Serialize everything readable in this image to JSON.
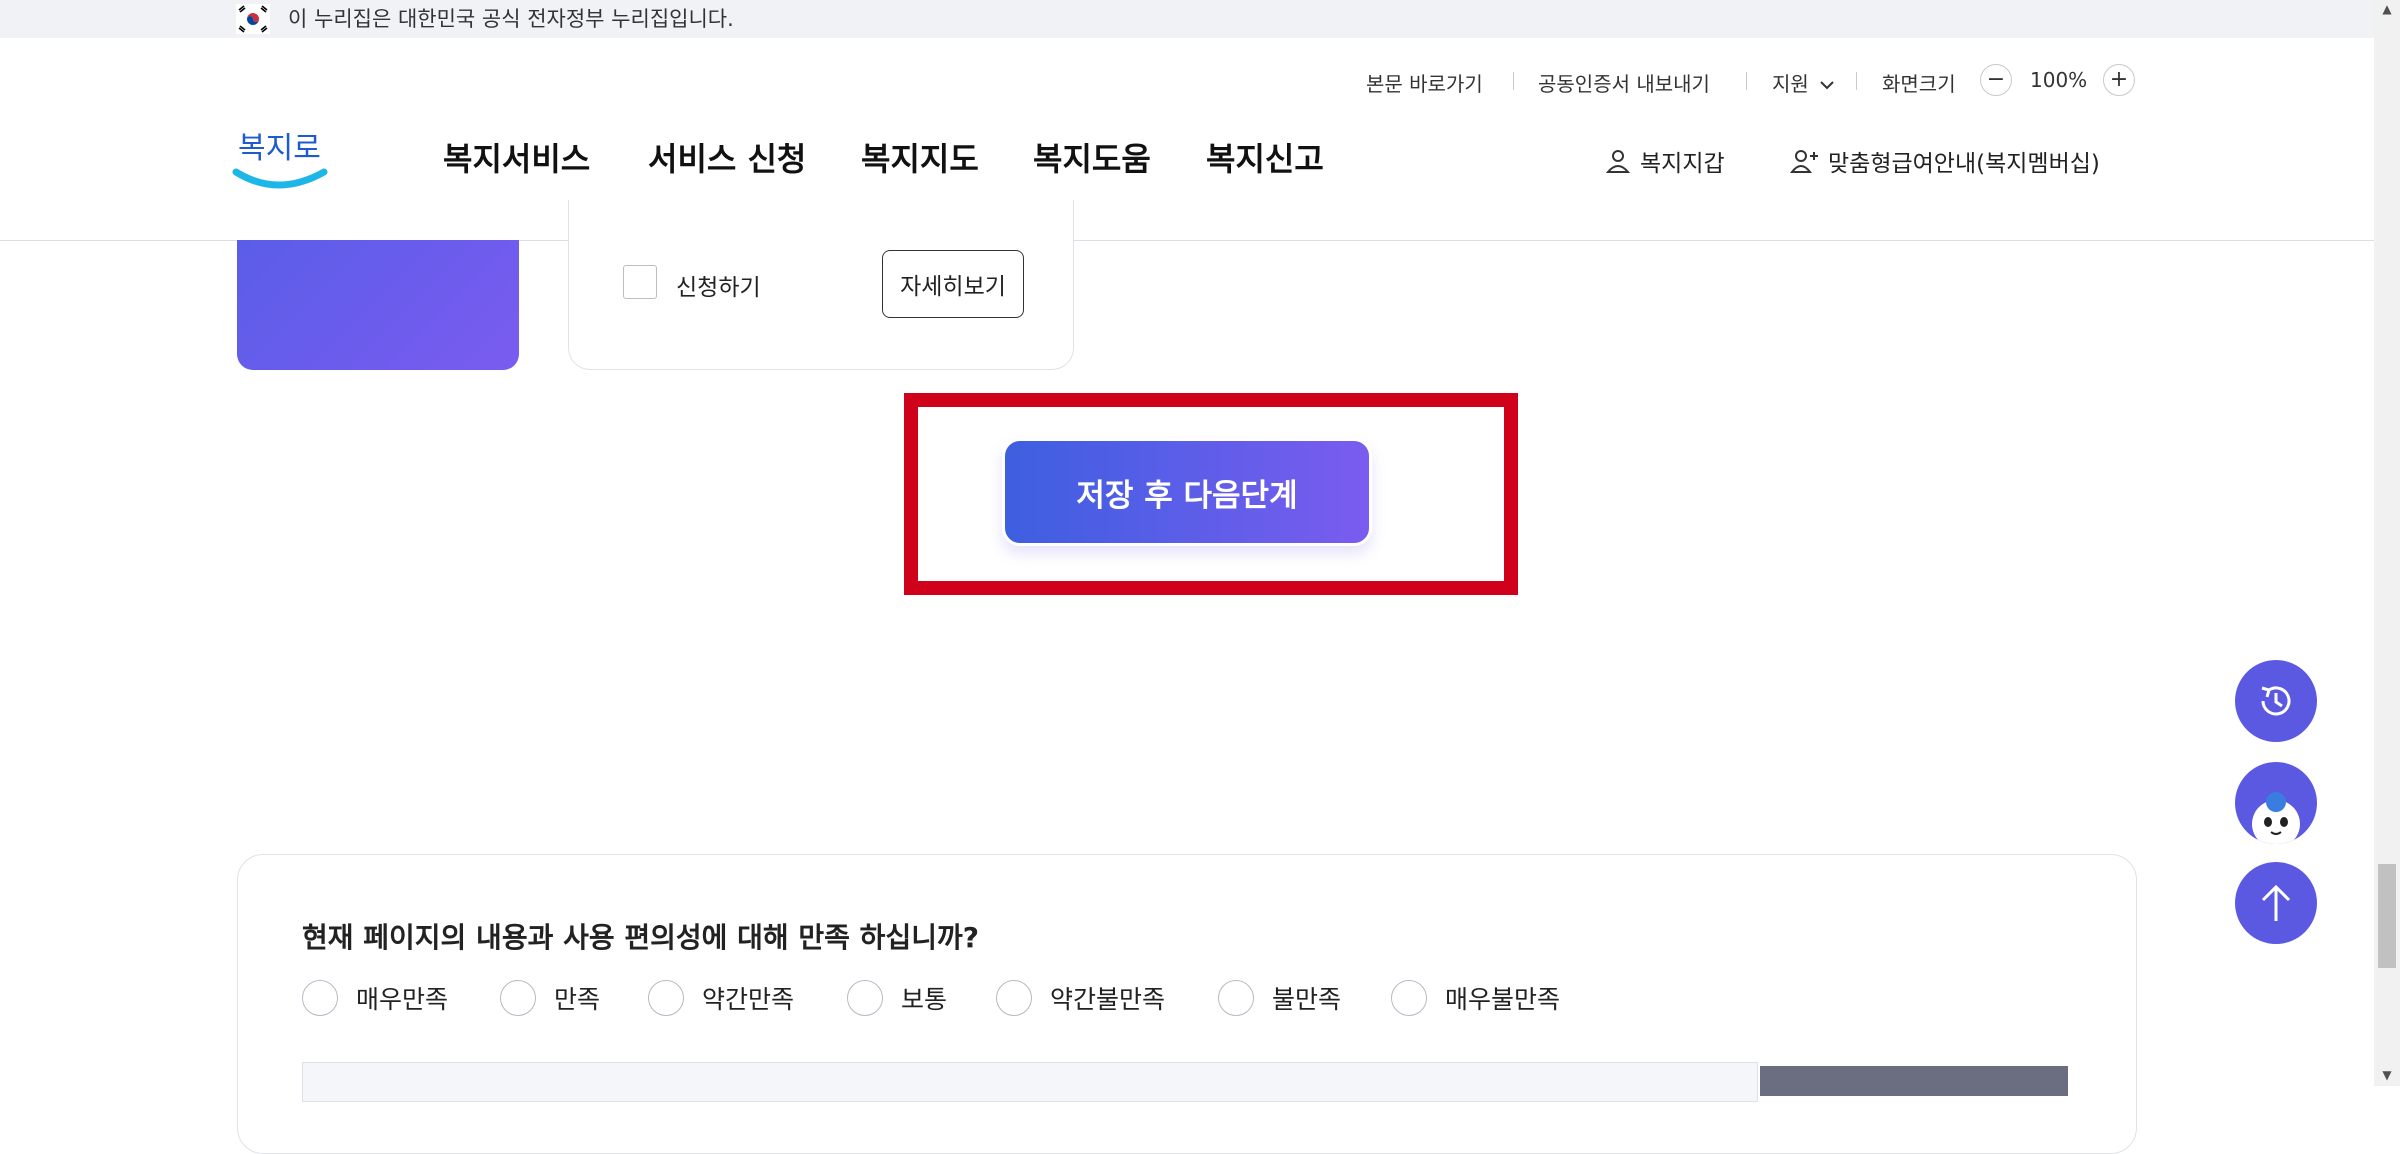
{
  "gov_banner": {
    "text": "이 누리집은 대한민국 공식 전자정부 누리집입니다."
  },
  "header": {
    "utility": {
      "skip_link": "본문 바로가기",
      "cert_export": "공동인증서 내보내기",
      "support": "지원",
      "zoom_label": "화면크기",
      "zoom_value": "100%",
      "zoom_out": "−",
      "zoom_in": "+"
    },
    "logo_text": "복지로",
    "nav": [
      "복지서비스",
      "서비스 신청",
      "복지지도",
      "복지도움",
      "복지신고"
    ],
    "wallet": "복지지갑",
    "membership": "맞춤형급여안내(복지멤버십)"
  },
  "service_card": {
    "apply_label": "신청하기",
    "detail_button": "자세히보기"
  },
  "next_button": "저장 후 다음단계",
  "survey": {
    "question": "현재 페이지의 내용과 사용 편의성에 대해 만족 하십니까?",
    "options": [
      "매우만족",
      "만족",
      "약간만족",
      "보통",
      "약간불만족",
      "불만족",
      "매우불만족"
    ]
  },
  "colors": {
    "accent": "#5b59e2",
    "highlight_frame": "#d0021b"
  }
}
